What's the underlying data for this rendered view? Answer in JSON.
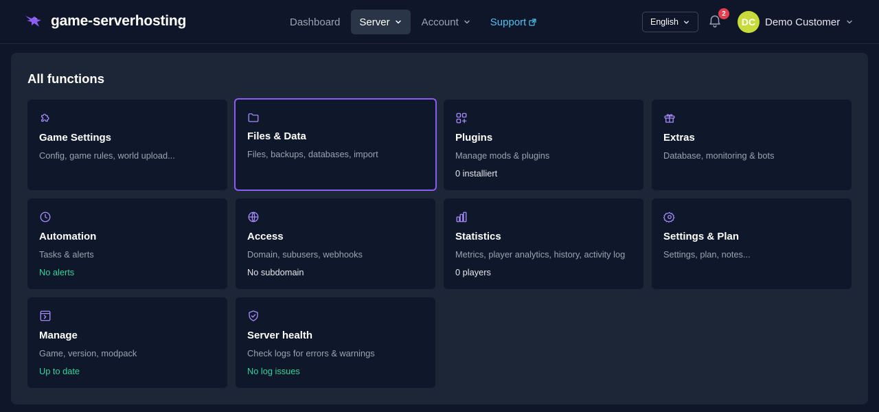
{
  "header": {
    "brand": "game-serverhosting",
    "nav": [
      {
        "label": "Dashboard"
      },
      {
        "label": "Server"
      },
      {
        "label": "Account"
      },
      {
        "label": "Support"
      }
    ],
    "language": "English",
    "notifications_count": "2",
    "user": {
      "initials": "DC",
      "name": "Demo Customer"
    }
  },
  "colors": {
    "accent": "#8b5cf6",
    "support_link": "#4cc3f0",
    "status_ok": "#34d399",
    "badge": "#e53e4f",
    "avatar": "#c7dc3b"
  },
  "main": {
    "title": "All functions",
    "cards": [
      {
        "icon": "puzzle-icon",
        "title": "Game Settings",
        "desc": "Config, game rules, world upload...",
        "status": ""
      },
      {
        "icon": "folder-icon",
        "title": "Files & Data",
        "desc": "Files, backups, databases, import",
        "status": ""
      },
      {
        "icon": "plugins-grid-icon",
        "title": "Plugins",
        "desc": "Manage mods & plugins",
        "status": "0 installiert"
      },
      {
        "icon": "gift-icon",
        "title": "Extras",
        "desc": "Database, monitoring & bots",
        "status": ""
      },
      {
        "icon": "clock-icon",
        "title": "Automation",
        "desc": "Tasks & alerts",
        "status": "No alerts"
      },
      {
        "icon": "globe-icon",
        "title": "Access",
        "desc": "Domain, subusers, webhooks",
        "status": "No subdomain"
      },
      {
        "icon": "bar-chart-icon",
        "title": "Statistics",
        "desc": "Metrics, player analytics, history, activity log",
        "status": "0 players"
      },
      {
        "icon": "gear-icon",
        "title": "Settings & Plan",
        "desc": "Settings, plan, notes...",
        "status": ""
      },
      {
        "icon": "terminal-window-icon",
        "title": "Manage",
        "desc": "Game, version, modpack",
        "status": "Up to date"
      },
      {
        "icon": "shield-check-icon",
        "title": "Server health",
        "desc": "Check logs for errors & warnings",
        "status": "No log issues"
      }
    ]
  }
}
